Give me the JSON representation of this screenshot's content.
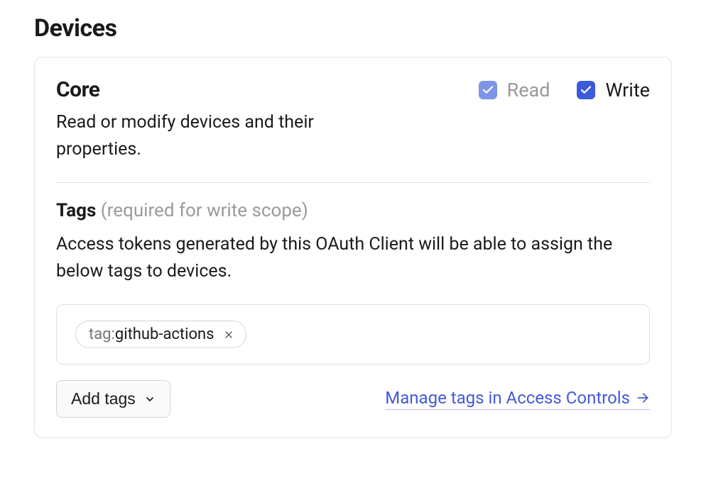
{
  "section": {
    "title": "Devices"
  },
  "core": {
    "title": "Core",
    "description": "Read or modify devices and their properties.",
    "readLabel": "Read",
    "writeLabel": "Write"
  },
  "tags": {
    "label": "Tags",
    "hint": "(required for write scope)",
    "description": "Access tokens generated by this OAuth Client will be able to assign the below tags to devices.",
    "chipPrefix": "tag:",
    "chipValue": "github-actions",
    "addButtonLabel": "Add tags",
    "manageLinkLabel": "Manage tags in Access Controls"
  }
}
